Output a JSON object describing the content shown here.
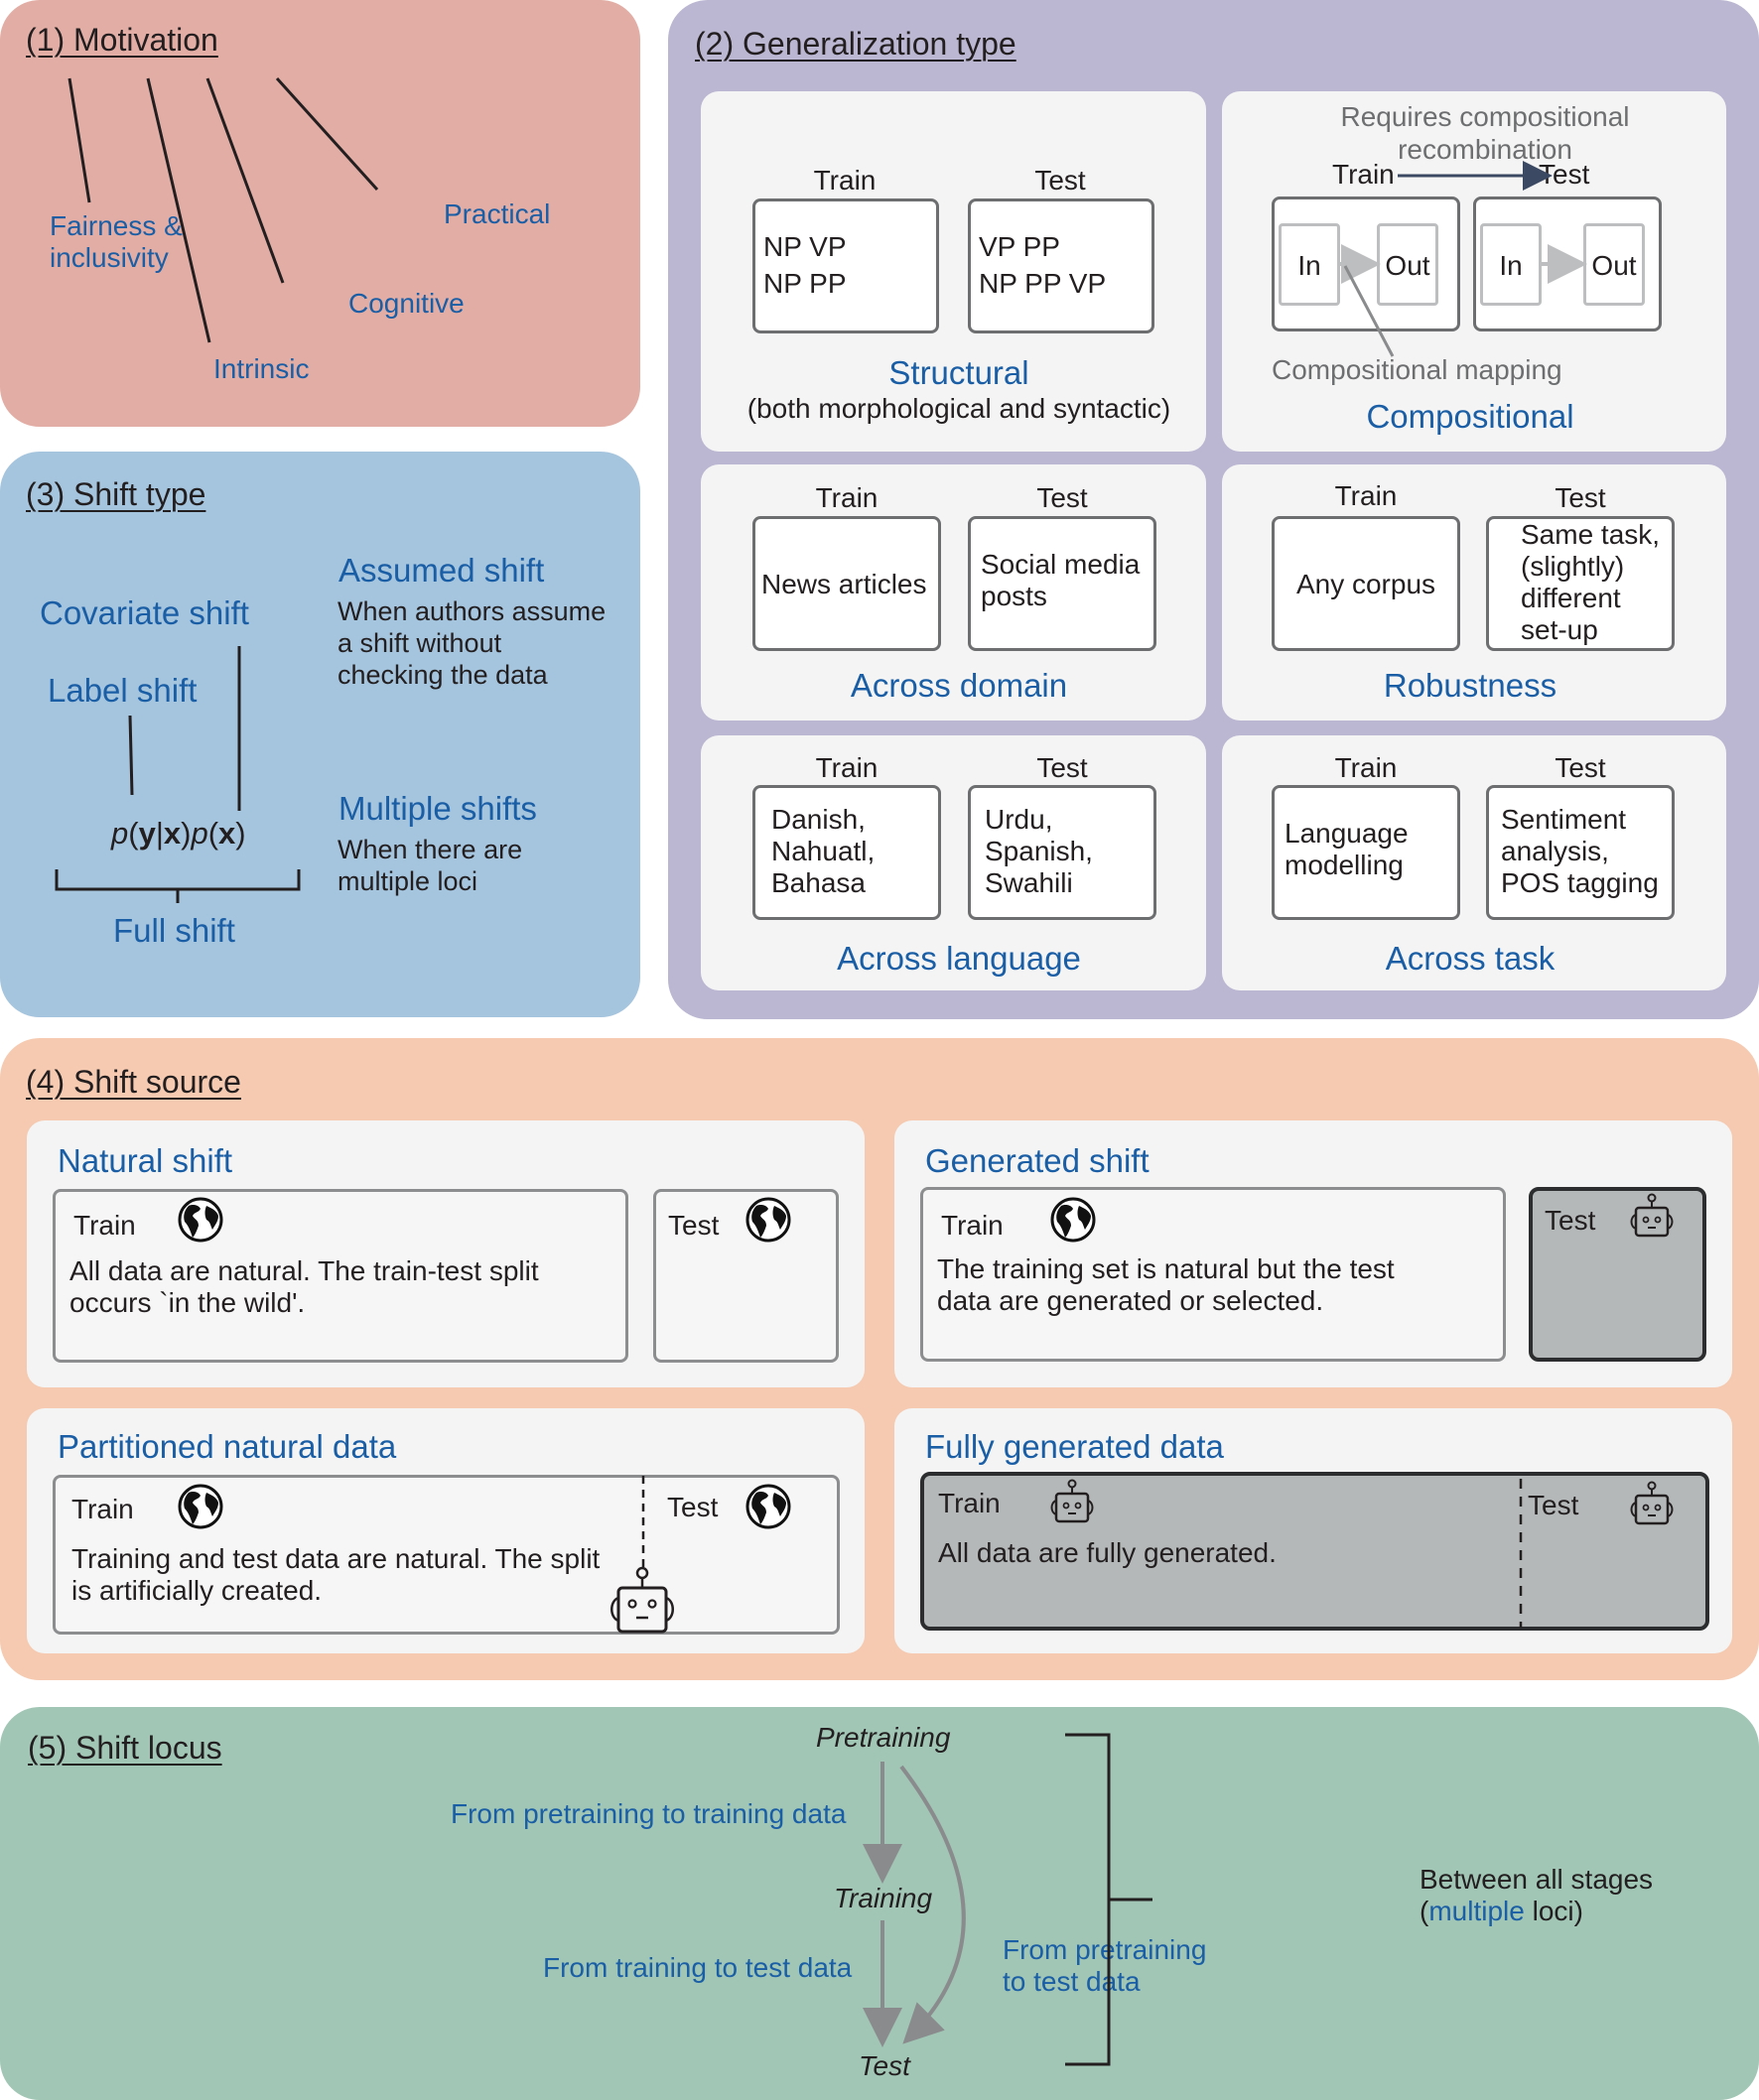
{
  "motivation": {
    "heading": "(1) Motivation",
    "items": [
      "Fairness &",
      "inclusivity",
      "Intrinsic",
      "Cognitive",
      "Practical"
    ]
  },
  "generalization_type": {
    "heading": "(2) Generalization type",
    "structural": {
      "train_label": "Train",
      "test_label": "Test",
      "train_lines": [
        "NP VP",
        "NP PP"
      ],
      "test_lines": [
        "VP PP",
        "NP PP VP"
      ],
      "title": "Structural",
      "subtitle": "(both morphological and syntactic)"
    },
    "compositional": {
      "note_line1": "Requires compositional",
      "note_line2": "recombination",
      "train_label": "Train",
      "test_label": "Test",
      "in_label": "In",
      "out_label": "Out",
      "mapping_label": "Compositional mapping",
      "title": "Compositional"
    },
    "across_domain": {
      "train_label": "Train",
      "test_label": "Test",
      "train_text": "News articles",
      "test_lines": [
        "Social media",
        "posts"
      ],
      "title": "Across domain"
    },
    "robustness": {
      "train_label": "Train",
      "test_label": "Test",
      "train_text": "Any corpus",
      "test_lines": [
        "Same task,",
        "(slightly)",
        "different",
        "set-up"
      ],
      "title": "Robustness"
    },
    "across_language": {
      "train_label": "Train",
      "test_label": "Test",
      "train_lines": [
        "Danish,",
        "Nahuatl,",
        "Bahasa"
      ],
      "test_lines": [
        "Urdu,",
        "Spanish,",
        "Swahili"
      ],
      "title": "Across language"
    },
    "across_task": {
      "train_label": "Train",
      "test_label": "Test",
      "train_lines": [
        "Language",
        "modelling"
      ],
      "test_lines": [
        "Sentiment",
        "analysis,",
        "POS tagging"
      ],
      "title": "Across task"
    }
  },
  "shift_type": {
    "heading": "(3) Shift type",
    "covariate": "Covariate shift",
    "label": "Label shift",
    "formula": {
      "p1": "p",
      "open1": "(",
      "y": "y",
      "bar": "|",
      "x1": "x",
      "close1": ")",
      "p2": "p",
      "open2": "(",
      "x2": "x",
      "close2": ")"
    },
    "full": "Full shift",
    "assumed_title": "Assumed shift",
    "assumed_lines": [
      "When authors assume",
      "a shift without",
      "checking the data"
    ],
    "multiple_title": "Multiple shifts",
    "multiple_lines": [
      "When there are",
      "multiple loci"
    ]
  },
  "shift_source": {
    "heading": "(4) Shift source",
    "natural": {
      "title": "Natural shift",
      "train_label": "Train",
      "test_label": "Test",
      "desc_lines": [
        "All data are natural. The train-test split",
        "occurs `in the wild'."
      ]
    },
    "generated": {
      "title": "Generated shift",
      "train_label": "Train",
      "test_label": "Test",
      "desc_lines": [
        "The training set is natural but the test",
        "data are generated or selected."
      ]
    },
    "partitioned": {
      "title": "Partitioned natural data",
      "train_label": "Train",
      "test_label": "Test",
      "desc_lines": [
        "Training and test data are natural. The split",
        "is artificially created."
      ]
    },
    "fully_generated": {
      "title": "Fully generated data",
      "train_label": "Train",
      "test_label": "Test",
      "desc": "All data are fully generated."
    }
  },
  "shift_locus": {
    "heading": "(5) Shift locus",
    "stages": [
      "Pretraining",
      "Training",
      "Test"
    ],
    "pre_to_train": "From pretraining to training data",
    "train_to_test": "From training to test data",
    "pre_to_test_lines": [
      "From pretraining",
      "to test data"
    ],
    "between_line1": "Between all stages",
    "between_open": "(",
    "between_multiple": "multiple",
    "between_close": " loci)"
  },
  "colors": {
    "motivation_bg": "#e2ada4",
    "generalization_bg": "#bbb6d1",
    "shift_type_bg": "#a5c4dd",
    "shift_source_bg": "#f5cab1",
    "shift_locus_bg": "#a1c6b5",
    "accent_blue": "#1a5ea6",
    "generated_box": "#b5b8b9"
  }
}
